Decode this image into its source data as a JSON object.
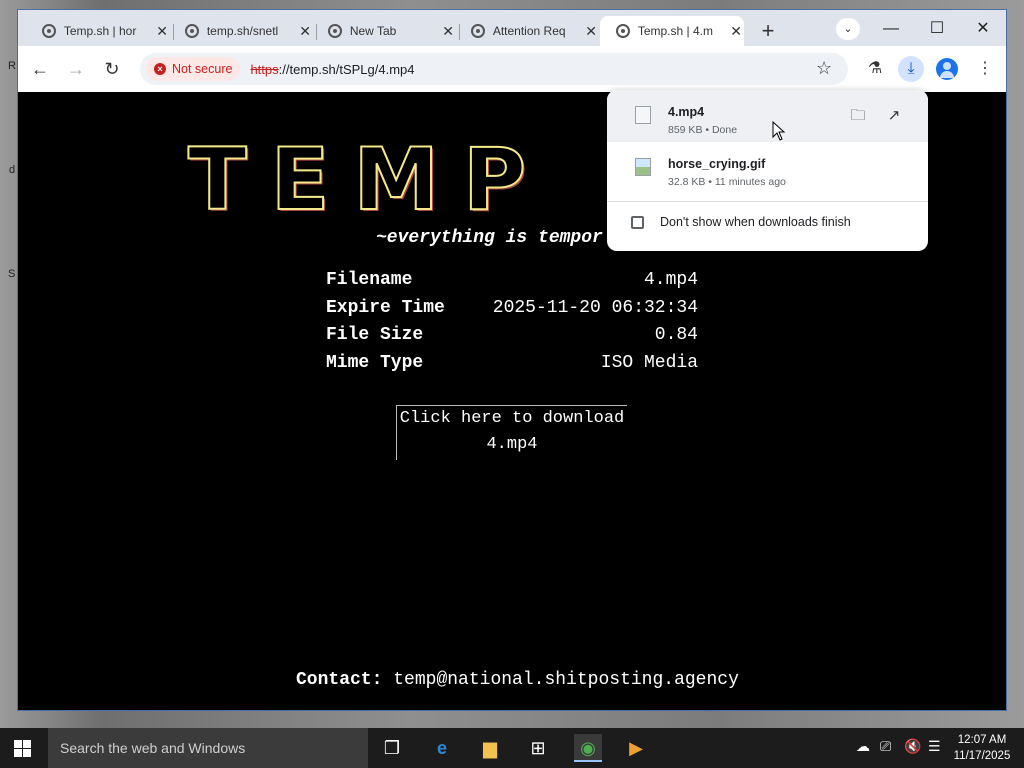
{
  "desktop": {
    "side_letters": [
      "R",
      "d",
      "S"
    ]
  },
  "tabs": [
    {
      "title": "Temp.sh | hor",
      "active": false
    },
    {
      "title": "temp.sh/snetl",
      "active": false
    },
    {
      "title": "New Tab",
      "active": false
    },
    {
      "title": "Attention Req",
      "active": false
    },
    {
      "title": "Temp.sh | 4.m",
      "active": true
    }
  ],
  "tab_search_icon": "chevron-down",
  "window_controls": {
    "minimize": "—",
    "maximize": "☐",
    "close": "✕"
  },
  "toolbar": {
    "security_label": "Not secure",
    "url_scheme": "https",
    "url_rest": "://temp.sh/tSPLg/4.mp4"
  },
  "page": {
    "logo_text": "TEMP",
    "tagline": "~everything is tempor",
    "info_rows": [
      {
        "label": "Filename",
        "value": "4.mp4"
      },
      {
        "label": "Expire Time",
        "value": "2025-11-20 06:32:34"
      },
      {
        "label": "File Size",
        "value": "0.84"
      },
      {
        "label": "Mime Type",
        "value": "ISO Media"
      }
    ],
    "download_line1": "Click here to download",
    "download_line2": "4.mp4",
    "contact_label": "Contact:",
    "contact_email": "temp@national.shitposting.agency"
  },
  "downloads_bubble": {
    "items": [
      {
        "name": "4.mp4",
        "meta": "859 KB • Done",
        "icon": "video-file-icon"
      },
      {
        "name": "horse_crying.gif",
        "meta": "32.8 KB • 11 minutes ago",
        "icon": "image-file-icon"
      }
    ],
    "checkbox_label": "Don't show when downloads finish",
    "checkbox_checked": false
  },
  "taskbar": {
    "search_placeholder": "Search the web and Windows",
    "time": "12:07 AM",
    "date": "11/17/2025"
  }
}
